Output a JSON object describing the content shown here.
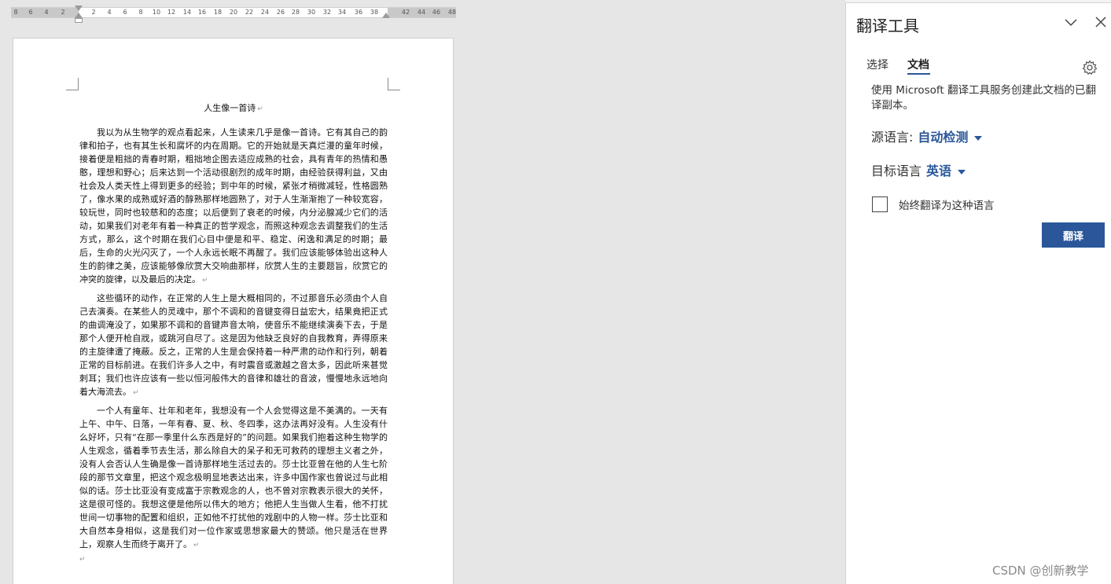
{
  "ruler": {
    "ticks": [
      "8",
      "6",
      "4",
      "2",
      "2",
      "4",
      "6",
      "8",
      "10",
      "12",
      "14",
      "16",
      "18",
      "20",
      "22",
      "24",
      "26",
      "28",
      "30",
      "32",
      "34",
      "36",
      "38",
      "42",
      "44",
      "46",
      "48"
    ]
  },
  "document": {
    "title": "人生像一首诗",
    "paragraphs": [
      "我以为从生物学的观点看起来，人生读来几乎是像一首诗。它有其自己的韵律和拍子，也有其生长和腐坏的内在周期。它的开始就是天真烂漫的童年时候，接着便是粗拙的青春时期，粗拙地企图去适应成熟的社会，具有青年的热情和愚憨，理想和野心；后来达到一个活动很剧烈的成年时期，由经验获得利益，又由社会及人类天性上得到更多的经验；到中年的时候，紧张才稍微减轻，性格圆熟了，像水果的成熟或好酒的醇熟那样地圆熟了，对于人生渐渐抱了一种较宽容，较玩世，同时也较慈和的态度；以后便到了衰老的时候，内分泌腺减少它们的活动，如果我们对老年有着一种真正的哲学观念，而照这种观念去调整我们的生活方式，那么，这个时期在我们心目中便是和平、稳定、闲逸和满足的时期；最后，生命的火光闪灭了，一个人永远长眠不再醒了。我们应该能够体验出这种人生的韵律之美，应该能够像欣赏大交响曲那样，欣赏人生的主要题旨，欣赏它的冲突的旋律，以及最后的决定。",
      "这些循环的动作，在正常的人生上是大概相同的，不过那音乐必须由个人自己去演奏。在某些人的灵魂中，那个不调和的音键变得日益宏大，结果竟把正式的曲调淹没了，如果那不调和的音键声音太响，使音乐不能继续演奏下去，于是那个人便开枪自戕，或跳河自尽了。这是因为他缺乏良好的自我教育，弄得原来的主旋律遭了掩蔽。反之，正常的人生是会保持着一种严肃的动作和行列，朝着正常的目标前进。在我们许多人之中，有时震音或激越之音太多，因此听来甚觉刺耳；我们也许应该有一些以恒河般伟大的音律和雄壮的音波，慢慢地永远地向着大海流去。",
      "一个人有童年、壮年和老年，我想没有一个人会觉得这是不美满的。一天有上午、中午、日落，一年有春、夏、秋、冬四季，这办法再好没有。人生没有什么好坏，只有“在那一季里什么东西是好的”的问题。如果我们抱着这种生物学的人生观念，循着季节去生活，那么除自大的呆子和无可救药的理想主义者之外，没有人会否认人生确是像一首诗那样地生活过去的。莎士比亚曾在他的人生七阶段的那节文章里，把这个观念极明显地表达出来，许多中国作家也曾说过与此相似的话。莎士比亚没有变成富于宗教观念的人，也不曾对宗教表示很大的关怀，这是很可怪的。我想这便是他所以伟大的地方；他把人生当做人生看，他不打扰世间一切事物的配置和组织，正如他不打扰他的戏剧中的人物一样。莎士比亚和大自然本身相似，这是我们对一位作家或思想家最大的赞颂。他只是活在世界上，观察人生而终于离开了。"
    ]
  },
  "pane": {
    "title": "翻译工具",
    "tabs": [
      {
        "label": "选择"
      },
      {
        "label": "文档"
      }
    ],
    "description": "使用 Microsoft 翻译工具服务创建此文档的已翻译副本。",
    "source_label": "源语言:",
    "source_value": "自动检测",
    "target_label": "目标语言",
    "target_value": "英语",
    "always_translate_label": "始终翻译为这种语言",
    "always_translate_checked": false,
    "translate_button": "翻译",
    "accent_color": "#2b579a"
  },
  "watermark": "CSDN @创新教学"
}
